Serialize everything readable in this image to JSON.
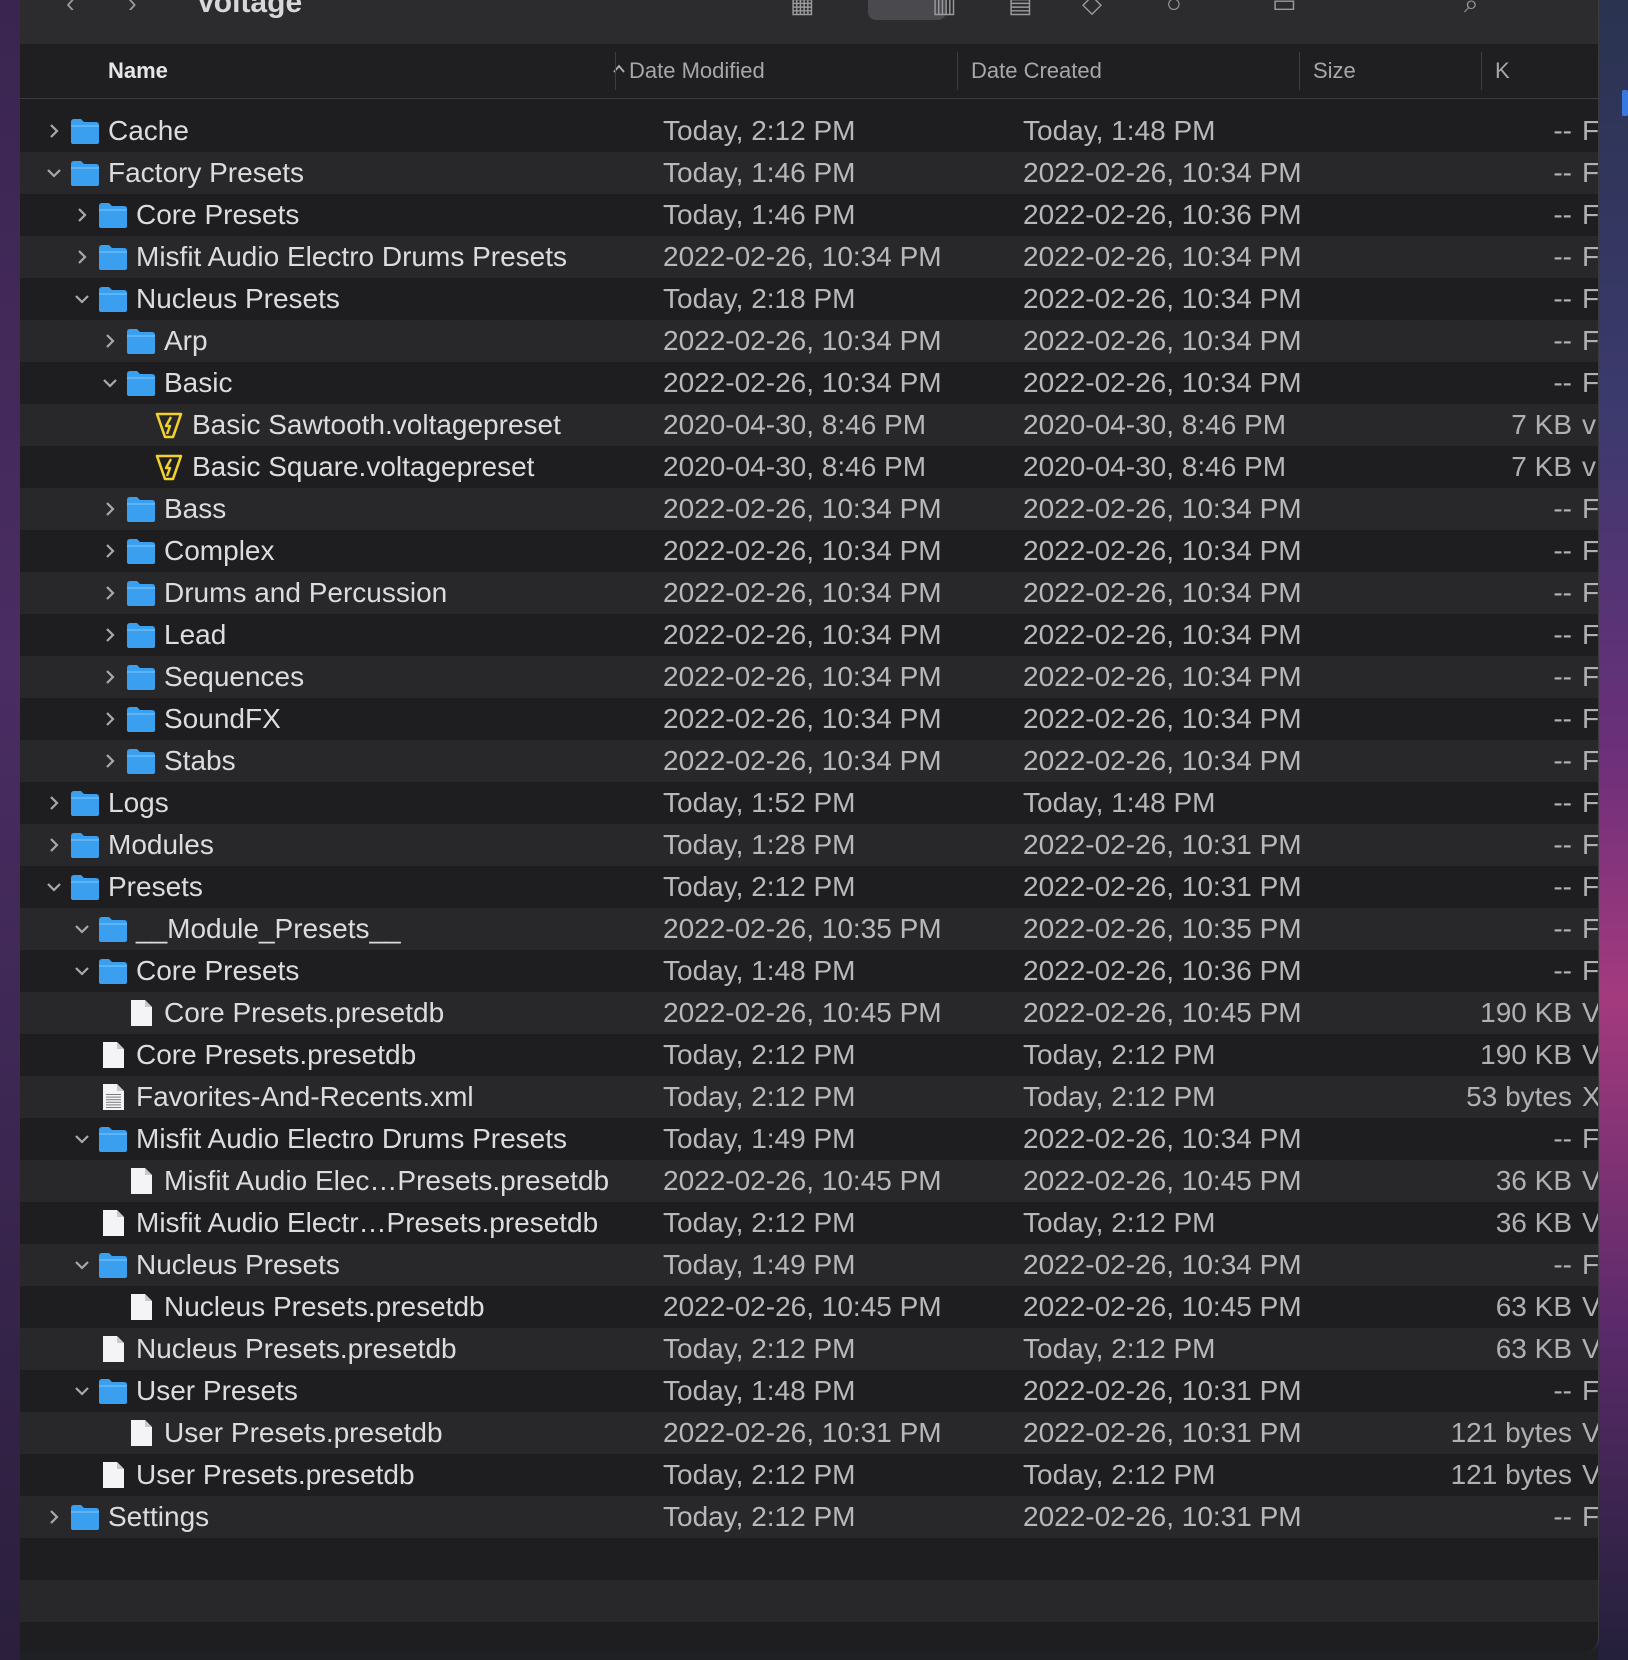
{
  "window": {
    "title": "Voltage"
  },
  "columns": {
    "name": "Name",
    "date_modified": "Date Modified",
    "date_created": "Date Created",
    "size": "Size",
    "kind": "K"
  },
  "rows": [
    {
      "depth": 0,
      "disc": "collapsed",
      "icon": "folder",
      "name": "Cache",
      "modified": "Today, 2:12 PM",
      "created": "Today, 1:48 PM",
      "size": "--",
      "kind": "F"
    },
    {
      "depth": 0,
      "disc": "expanded",
      "icon": "folder",
      "name": "Factory Presets",
      "modified": "Today, 1:46 PM",
      "created": "2022-02-26, 10:34 PM",
      "size": "--",
      "kind": "F"
    },
    {
      "depth": 1,
      "disc": "collapsed",
      "icon": "folder",
      "name": "Core Presets",
      "modified": "Today, 1:46 PM",
      "created": "2022-02-26, 10:36 PM",
      "size": "--",
      "kind": "F"
    },
    {
      "depth": 1,
      "disc": "collapsed",
      "icon": "folder",
      "name": "Misfit Audio Electro Drums Presets",
      "modified": "2022-02-26, 10:34 PM",
      "created": "2022-02-26, 10:34 PM",
      "size": "--",
      "kind": "F"
    },
    {
      "depth": 1,
      "disc": "expanded",
      "icon": "folder",
      "name": "Nucleus Presets",
      "modified": "Today, 2:18 PM",
      "created": "2022-02-26, 10:34 PM",
      "size": "--",
      "kind": "F"
    },
    {
      "depth": 2,
      "disc": "collapsed",
      "icon": "folder",
      "name": "Arp",
      "modified": "2022-02-26, 10:34 PM",
      "created": "2022-02-26, 10:34 PM",
      "size": "--",
      "kind": "F"
    },
    {
      "depth": 2,
      "disc": "expanded",
      "icon": "folder",
      "name": "Basic",
      "modified": "2022-02-26, 10:34 PM",
      "created": "2022-02-26, 10:34 PM",
      "size": "--",
      "kind": "F"
    },
    {
      "depth": 3,
      "disc": "none",
      "icon": "voltage",
      "name": "Basic Sawtooth.voltagepreset",
      "modified": "2020-04-30, 8:46 PM",
      "created": "2020-04-30, 8:46 PM",
      "size": "7 KB",
      "kind": "v"
    },
    {
      "depth": 3,
      "disc": "none",
      "icon": "voltage",
      "name": "Basic Square.voltagepreset",
      "modified": "2020-04-30, 8:46 PM",
      "created": "2020-04-30, 8:46 PM",
      "size": "7 KB",
      "kind": "v"
    },
    {
      "depth": 2,
      "disc": "collapsed",
      "icon": "folder",
      "name": "Bass",
      "modified": "2022-02-26, 10:34 PM",
      "created": "2022-02-26, 10:34 PM",
      "size": "--",
      "kind": "F"
    },
    {
      "depth": 2,
      "disc": "collapsed",
      "icon": "folder",
      "name": "Complex",
      "modified": "2022-02-26, 10:34 PM",
      "created": "2022-02-26, 10:34 PM",
      "size": "--",
      "kind": "F"
    },
    {
      "depth": 2,
      "disc": "collapsed",
      "icon": "folder",
      "name": "Drums and Percussion",
      "modified": "2022-02-26, 10:34 PM",
      "created": "2022-02-26, 10:34 PM",
      "size": "--",
      "kind": "F"
    },
    {
      "depth": 2,
      "disc": "collapsed",
      "icon": "folder",
      "name": "Lead",
      "modified": "2022-02-26, 10:34 PM",
      "created": "2022-02-26, 10:34 PM",
      "size": "--",
      "kind": "F"
    },
    {
      "depth": 2,
      "disc": "collapsed",
      "icon": "folder",
      "name": "Sequences",
      "modified": "2022-02-26, 10:34 PM",
      "created": "2022-02-26, 10:34 PM",
      "size": "--",
      "kind": "F"
    },
    {
      "depth": 2,
      "disc": "collapsed",
      "icon": "folder",
      "name": "SoundFX",
      "modified": "2022-02-26, 10:34 PM",
      "created": "2022-02-26, 10:34 PM",
      "size": "--",
      "kind": "F"
    },
    {
      "depth": 2,
      "disc": "collapsed",
      "icon": "folder",
      "name": "Stabs",
      "modified": "2022-02-26, 10:34 PM",
      "created": "2022-02-26, 10:34 PM",
      "size": "--",
      "kind": "F"
    },
    {
      "depth": 0,
      "disc": "collapsed",
      "icon": "folder",
      "name": "Logs",
      "modified": "Today, 1:52 PM",
      "created": "Today, 1:48 PM",
      "size": "--",
      "kind": "F"
    },
    {
      "depth": 0,
      "disc": "collapsed",
      "icon": "folder",
      "name": "Modules",
      "modified": "Today, 1:28 PM",
      "created": "2022-02-26, 10:31 PM",
      "size": "--",
      "kind": "F"
    },
    {
      "depth": 0,
      "disc": "expanded",
      "icon": "folder",
      "name": "Presets",
      "modified": "Today, 2:12 PM",
      "created": "2022-02-26, 10:31 PM",
      "size": "--",
      "kind": "F"
    },
    {
      "depth": 1,
      "disc": "expanded",
      "icon": "folder",
      "name": "__Module_Presets__",
      "modified": "2022-02-26, 10:35 PM",
      "created": "2022-02-26, 10:35 PM",
      "size": "--",
      "kind": "F"
    },
    {
      "depth": 1,
      "disc": "expanded",
      "icon": "folder",
      "name": "Core Presets",
      "modified": "Today, 1:48 PM",
      "created": "2022-02-26, 10:36 PM",
      "size": "--",
      "kind": "F"
    },
    {
      "depth": 2,
      "disc": "none",
      "icon": "doc",
      "name": "Core Presets.presetdb",
      "modified": "2022-02-26, 10:45 PM",
      "created": "2022-02-26, 10:45 PM",
      "size": "190 KB",
      "kind": "V"
    },
    {
      "depth": 1,
      "disc": "none",
      "icon": "doc",
      "name": "Core Presets.presetdb",
      "modified": "Today, 2:12 PM",
      "created": "Today, 2:12 PM",
      "size": "190 KB",
      "kind": "V"
    },
    {
      "depth": 1,
      "disc": "none",
      "icon": "text",
      "name": "Favorites-And-Recents.xml",
      "modified": "Today, 2:12 PM",
      "created": "Today, 2:12 PM",
      "size": "53 bytes",
      "kind": "X"
    },
    {
      "depth": 1,
      "disc": "expanded",
      "icon": "folder",
      "name": "Misfit Audio Electro Drums Presets",
      "modified": "Today, 1:49 PM",
      "created": "2022-02-26, 10:34 PM",
      "size": "--",
      "kind": "F"
    },
    {
      "depth": 2,
      "disc": "none",
      "icon": "doc",
      "name": "Misfit Audio Elec…Presets.presetdb",
      "modified": "2022-02-26, 10:45 PM",
      "created": "2022-02-26, 10:45 PM",
      "size": "36 KB",
      "kind": "V"
    },
    {
      "depth": 1,
      "disc": "none",
      "icon": "doc",
      "name": "Misfit Audio Electr…Presets.presetdb",
      "modified": "Today, 2:12 PM",
      "created": "Today, 2:12 PM",
      "size": "36 KB",
      "kind": "V"
    },
    {
      "depth": 1,
      "disc": "expanded",
      "icon": "folder",
      "name": "Nucleus Presets",
      "modified": "Today, 1:49 PM",
      "created": "2022-02-26, 10:34 PM",
      "size": "--",
      "kind": "F"
    },
    {
      "depth": 2,
      "disc": "none",
      "icon": "doc",
      "name": "Nucleus Presets.presetdb",
      "modified": "2022-02-26, 10:45 PM",
      "created": "2022-02-26, 10:45 PM",
      "size": "63 KB",
      "kind": "V"
    },
    {
      "depth": 1,
      "disc": "none",
      "icon": "doc",
      "name": "Nucleus Presets.presetdb",
      "modified": "Today, 2:12 PM",
      "created": "Today, 2:12 PM",
      "size": "63 KB",
      "kind": "V"
    },
    {
      "depth": 1,
      "disc": "expanded",
      "icon": "folder",
      "name": "User Presets",
      "modified": "Today, 1:48 PM",
      "created": "2022-02-26, 10:31 PM",
      "size": "--",
      "kind": "F"
    },
    {
      "depth": 2,
      "disc": "none",
      "icon": "doc",
      "name": "User Presets.presetdb",
      "modified": "2022-02-26, 10:31 PM",
      "created": "2022-02-26, 10:31 PM",
      "size": "121 bytes",
      "kind": "V"
    },
    {
      "depth": 1,
      "disc": "none",
      "icon": "doc",
      "name": "User Presets.presetdb",
      "modified": "Today, 2:12 PM",
      "created": "Today, 2:12 PM",
      "size": "121 bytes",
      "kind": "V"
    },
    {
      "depth": 0,
      "disc": "collapsed",
      "icon": "folder",
      "name": "Settings",
      "modified": "Today, 2:12 PM",
      "created": "2022-02-26, 10:31 PM",
      "size": "--",
      "kind": "F"
    }
  ],
  "colors": {
    "folder": "#3b9ff0",
    "folder_tab": "#5db3f7",
    "voltage": "#f2d22a",
    "accent": "#3a78e0"
  },
  "icons": {
    "folder": "folder-icon",
    "voltage": "voltage-preset-icon",
    "doc": "document-icon",
    "text": "text-document-icon",
    "sort": "sort-ascending-icon"
  }
}
